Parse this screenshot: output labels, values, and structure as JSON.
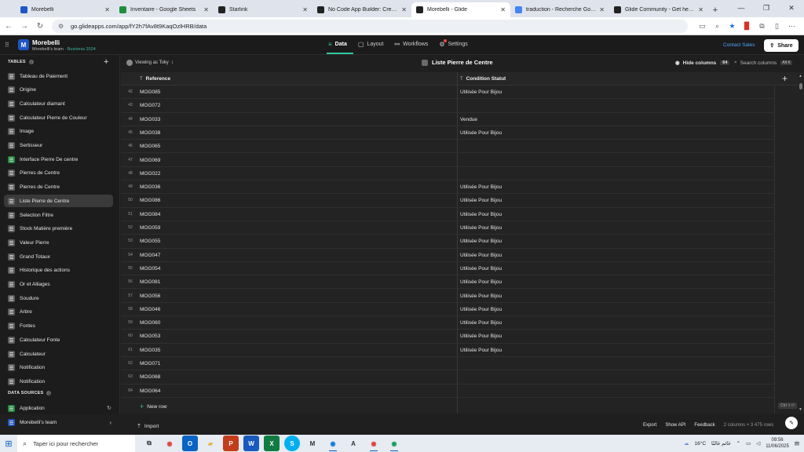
{
  "browser": {
    "tabs": [
      {
        "title": "Morebelli",
        "color": "#1e56c6",
        "active": false
      },
      {
        "title": "Inventaire - Google Sheets",
        "color": "#1e8e3e",
        "active": false
      },
      {
        "title": "Starlink",
        "color": "#222222",
        "active": false
      },
      {
        "title": "No Code App Builder: Create C",
        "color": "#222222",
        "active": false
      },
      {
        "title": "Morebelli - Glide",
        "color": "#222222",
        "active": true
      },
      {
        "title": "traduction - Recherche Google",
        "color": "#4285f4",
        "active": false
      },
      {
        "title": "Glide Community - Get help w",
        "color": "#222222",
        "active": false
      }
    ],
    "url": "go.glideapps.com/app/fY2h7fAv8t9KaqOzlHRB/data"
  },
  "app": {
    "name": "Morebelli",
    "team": "Morebelli's team",
    "plan": "Business 2024",
    "nav": [
      {
        "label": "Data",
        "icon": "database-icon",
        "active": true
      },
      {
        "label": "Layout",
        "icon": "layout-icon",
        "active": false
      },
      {
        "label": "Workflows",
        "icon": "workflows-icon",
        "active": false
      },
      {
        "label": "Settings",
        "icon": "gear-icon",
        "active": false
      }
    ],
    "contact_label": "Contact Sales",
    "share_label": "Share"
  },
  "sidebar": {
    "tables_header": "TABLES",
    "tables": [
      {
        "label": "Tableau de Paiement",
        "green": false
      },
      {
        "label": "Origine",
        "green": false
      },
      {
        "label": "Calculateur diamant",
        "green": false
      },
      {
        "label": "Calculateur Pierre de Couleur",
        "green": false
      },
      {
        "label": "Image",
        "green": false
      },
      {
        "label": "Sertisseur",
        "green": false
      },
      {
        "label": "Interface Pierre De centre",
        "green": true
      },
      {
        "label": "Pierres de Centre",
        "green": false
      },
      {
        "label": "Pierres de Centre",
        "green": false
      },
      {
        "label": "Liste Pierre de Centre",
        "green": false,
        "active": true
      },
      {
        "label": "Selection Filtre",
        "green": false
      },
      {
        "label": "Stock Matière première",
        "green": false
      },
      {
        "label": "Valeur Pierre",
        "green": false
      },
      {
        "label": "Grand Totaux",
        "green": false
      },
      {
        "label": "Historique des actions",
        "green": false
      },
      {
        "label": "Or et Alliages",
        "green": false
      },
      {
        "label": "Soudure",
        "green": false
      },
      {
        "label": "Arbre",
        "green": false
      },
      {
        "label": "Fontes",
        "green": false
      },
      {
        "label": "Calculateur Fonte",
        "green": false
      },
      {
        "label": "Calculateur",
        "green": false
      },
      {
        "label": "Notification",
        "green": false
      },
      {
        "label": "Notification",
        "green": false
      }
    ],
    "sources_header": "DATA SOURCES",
    "sources": [
      {
        "label": "Application",
        "icon": "sheets-icon"
      },
      {
        "label": "Morebelli's team",
        "icon": "team-icon"
      }
    ]
  },
  "toolbar": {
    "viewing_as": "Viewing as Toky",
    "table_title": "Liste Pierre de Centre",
    "hide_columns": "Hide columns",
    "hide_count": "64",
    "search_placeholder": "Search columns",
    "search_kbd": "Alt K"
  },
  "grid": {
    "columns": [
      "Reference",
      "Condition Statut"
    ],
    "rows": [
      {
        "n": "42",
        "ref": "MOG085",
        "cond": "Utilisée Pour Bijou"
      },
      {
        "n": "43",
        "ref": "MOG072",
        "cond": ""
      },
      {
        "n": "44",
        "ref": "MOG033",
        "cond": "Vendue"
      },
      {
        "n": "45",
        "ref": "MOG038",
        "cond": "Utilisée Pour Bijou"
      },
      {
        "n": "46",
        "ref": "MOG065",
        "cond": ""
      },
      {
        "n": "47",
        "ref": "MOG069",
        "cond": ""
      },
      {
        "n": "48",
        "ref": "MOG022",
        "cond": ""
      },
      {
        "n": "49",
        "ref": "MOG036",
        "cond": "Utilisée Pour Bijou"
      },
      {
        "n": "50",
        "ref": "MOG086",
        "cond": "Utilisée Pour Bijou"
      },
      {
        "n": "51",
        "ref": "MOG084",
        "cond": "Utilisée Pour Bijou"
      },
      {
        "n": "52",
        "ref": "MOG059",
        "cond": "Utilisée Pour Bijou"
      },
      {
        "n": "53",
        "ref": "MOG055",
        "cond": "Utilisée Pour Bijou"
      },
      {
        "n": "54",
        "ref": "MOG047",
        "cond": "Utilisée Pour Bijou"
      },
      {
        "n": "55",
        "ref": "MOG054",
        "cond": "Utilisée Pour Bijou"
      },
      {
        "n": "56",
        "ref": "MOG081",
        "cond": "Utilisée Pour Bijou"
      },
      {
        "n": "57",
        "ref": "MOG056",
        "cond": "Utilisée Pour Bijou"
      },
      {
        "n": "58",
        "ref": "MOG046",
        "cond": "Utilisée Pour Bijou"
      },
      {
        "n": "59",
        "ref": "MOG060",
        "cond": "Utilisée Pour Bijou"
      },
      {
        "n": "60",
        "ref": "MOG053",
        "cond": "Utilisée Pour Bijou"
      },
      {
        "n": "61",
        "ref": "MOG035",
        "cond": "Utilisée Pour Bijou"
      },
      {
        "n": "62",
        "ref": "MOG071",
        "cond": ""
      },
      {
        "n": "63",
        "ref": "MOG068",
        "cond": ""
      },
      {
        "n": "64",
        "ref": "MOG064",
        "cond": ""
      }
    ],
    "new_row": "New row",
    "ctrl_hint": "Ctrl ⇧⏎"
  },
  "footer": {
    "import": "Import",
    "export": "Export",
    "show_api": "Show API",
    "feedback": "Feedback",
    "rows_info": "2 columns × 3 475 rows"
  },
  "taskbar": {
    "search_placeholder": "Taper ici pour rechercher",
    "weather": "16°C",
    "weather_text": "غائم غالبًا",
    "time": "09:56",
    "date": "11/06/2025"
  }
}
